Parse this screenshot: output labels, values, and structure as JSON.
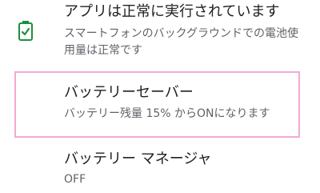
{
  "status": {
    "icon": "battery-check-icon",
    "title": "アプリは正常に実行されています",
    "summary": "スマートフォンのバックグラウンドでの電池使用量は正常です",
    "accent_color": "#1e8e3e"
  },
  "battery_saver": {
    "title": "バッテリーセーバー",
    "summary": "バッテリー残量 15% からONになります",
    "highlight_color": "#f4aad2"
  },
  "battery_manager": {
    "title": "バッテリー マネージャ",
    "summary": "OFF"
  }
}
